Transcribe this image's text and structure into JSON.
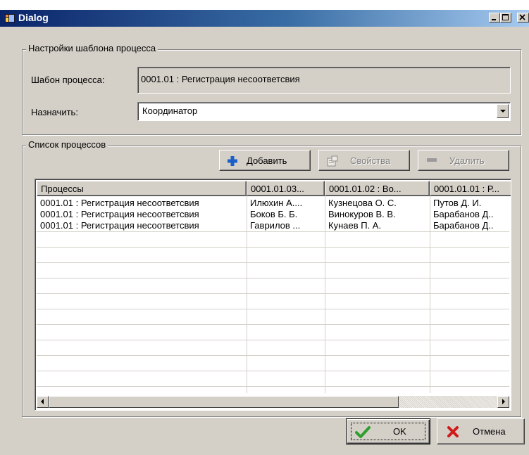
{
  "window": {
    "title": "Dialog",
    "controls": [
      "minimize-icon",
      "maximize-icon",
      "close-icon"
    ],
    "colors": {
      "face": "#d4d0c8",
      "title_start": "#0a246a",
      "title_end": "#a6caf0"
    }
  },
  "settings_group": {
    "title": "Настройки шаблона процесса",
    "template_label": "Шабон процесса:",
    "template_value": "0001.01 : Регистрация несоответсвия",
    "assign_label": "Назначить:",
    "assign_value": "Координатор"
  },
  "process_group": {
    "title": "Список процессов",
    "toolbar": {
      "add_label": "Добавить",
      "add_icon": "plus-icon",
      "add_color": "#1c5fc7",
      "properties_label": "Свойства",
      "properties_icon": "properties-icon",
      "delete_label": "Удалить",
      "delete_icon": "minus-icon"
    },
    "table": {
      "columns": [
        "Процессы",
        "0001.01.03...",
        "0001.01.02 : Во...",
        "0001.01.01 : Р..."
      ],
      "rows": [
        [
          "0001.01 : Регистрация несоответсвия",
          "Илюхин А....",
          "Кузнецова О. С.",
          "Путов Д. И."
        ],
        [
          "0001.01 : Регистрация несоответсвия",
          "Боков Б. Б.",
          "Винокуров В. В.",
          "Барабанов Д.."
        ],
        [
          "0001.01 : Регистрация несоответсвия",
          "Гаврилов ...",
          "Кунаев П. А.",
          "Барабанов Д.."
        ]
      ],
      "horizontal_scroll_fraction": 0.78
    }
  },
  "footer": {
    "ok_label": "OK",
    "ok_icon": "checkmark-icon",
    "ok_color": "#2e9e2e",
    "cancel_label": "Отмена",
    "cancel_icon": "x-icon",
    "cancel_color": "#d11a1a"
  }
}
